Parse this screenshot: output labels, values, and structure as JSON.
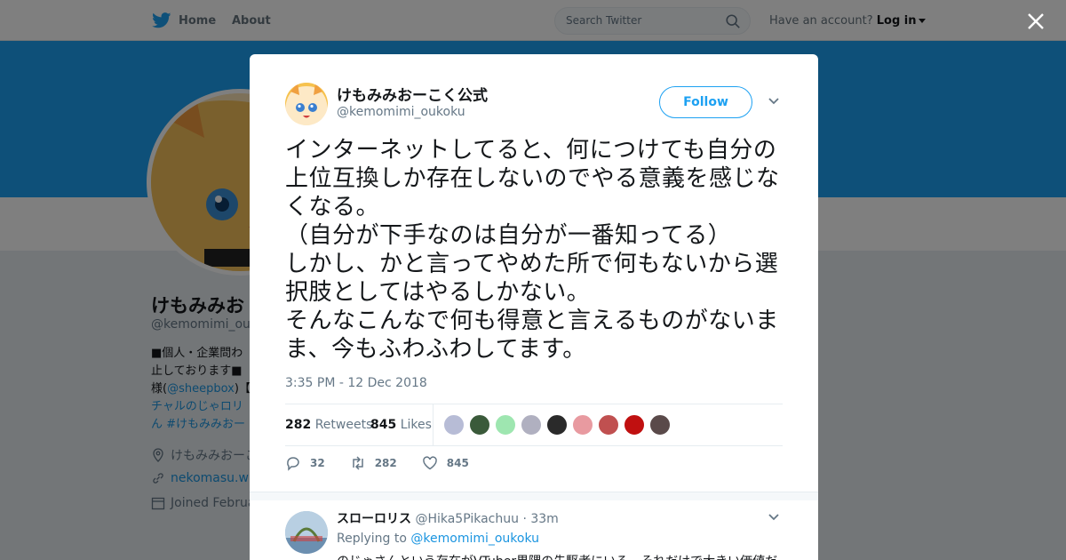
{
  "nav": {
    "home_label": "Home",
    "about_label": "About",
    "search_placeholder": "Search Twitter",
    "account_prompt": "Have an account?",
    "login_label": "Log in"
  },
  "profile": {
    "name": "けもみみお",
    "handle": "@kemomimi_ouko",
    "bio_lines": [
      "■個人・企業問わ",
      "止しております■",
      "様(",
      "@sheepbox",
      ")【",
      "チャルのじゃロリ",
      "ん #けもみみおー"
    ],
    "location": "けもみみおーこ",
    "website": "nekomasu.wix",
    "joined": "Joined Februa"
  },
  "tweet": {
    "author_name": "けもみみおーこく公式",
    "author_handle": "@kemomimi_oukoku",
    "follow_label": "Follow",
    "text": "インターネットしてると、何につけても自分の上位互換しか存在しないのでやる意義を感じなくなる。\n（自分が下手なのは自分が一番知ってる）\nしかし、かと言ってやめた所で何もないから選択肢としてはやるしかない。\nそんなこんなで何も得意と言えるものがないまま、今もふわふわしてます。",
    "timestamp": "3:35 PM - 12 Dec 2018",
    "retweets_count": "282",
    "retweets_label": "Retweets",
    "likes_count": "845",
    "likes_label": "Likes",
    "reply_count": "32",
    "retweet_action_count": "282",
    "like_action_count": "845",
    "liker_colors": [
      "#b7bcd6",
      "#3a5a3a",
      "#9ee6b0",
      "#b0b0c0",
      "#2a2a2a",
      "#e89aa0",
      "#c05050",
      "#c01010",
      "#5a4a4a"
    ]
  },
  "reply": {
    "author_name": "スローロリス",
    "author_handle": "@Hika5Pikachuu",
    "time": "33m",
    "replying_to_label": "Replying to",
    "replying_to_handle": "@kemomimi_oukoku",
    "text_start": "のじゃさんという存在がVTuber界隈の先駆者にいる。それだけで大きい価値だ"
  },
  "colors": {
    "twitter_blue": "#1da1f2",
    "link_blue": "#1b95e0",
    "muted": "#657786"
  }
}
